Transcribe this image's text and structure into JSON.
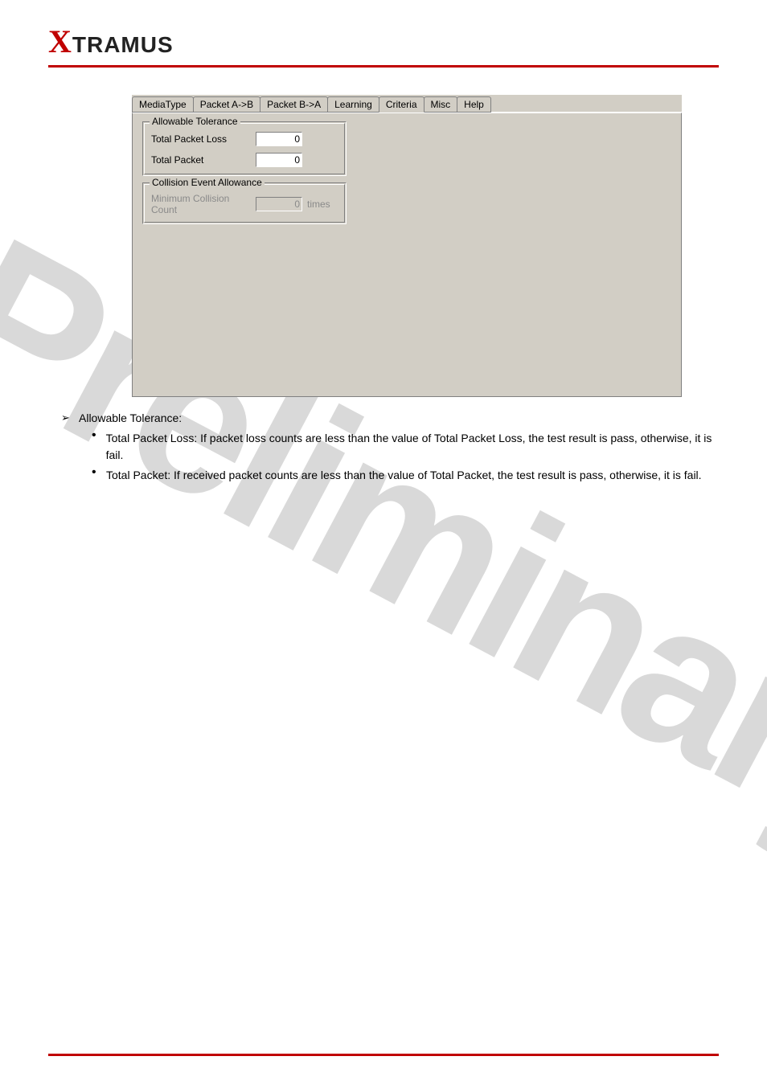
{
  "brand": {
    "x": "X",
    "rest": "TRAMUS"
  },
  "watermark": "Preliminary",
  "dialog": {
    "tabs": [
      "MediaType",
      "Packet A->B",
      "Packet B->A",
      "Learning",
      "Criteria",
      "Misc",
      "Help"
    ],
    "activeTabIndex": 4,
    "group_allowable": {
      "title": "Allowable Tolerance",
      "total_packet_loss_label": "Total Packet Loss",
      "total_packet_loss_value": "0",
      "total_packet_label": "Total Packet",
      "total_packet_value": "0"
    },
    "group_collision": {
      "title": "Collision Event Allowance",
      "min_collision_label": "Minimum Collision Count",
      "min_collision_value": "0",
      "unit": "times"
    }
  },
  "text": {
    "lvl1_heading": "Allowable Tolerance:",
    "bullet1": "Total Packet Loss: If packet loss counts are less than the value of Total Packet Loss, the test result is pass, otherwise, it is fail.",
    "bullet2": "Total Packet: If received packet counts are less than the value of Total Packet, the test result is pass, otherwise, it is fail."
  }
}
